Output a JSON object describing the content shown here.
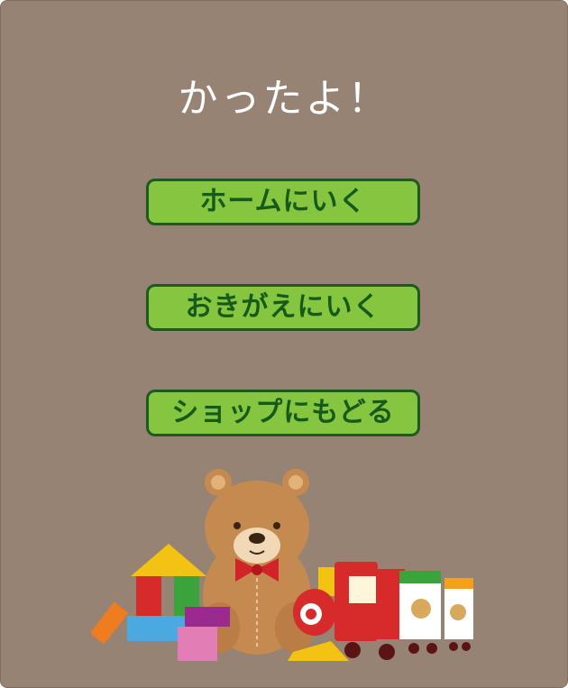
{
  "screen": {
    "title": "かったよ！"
  },
  "buttons": {
    "home": "ホームにいく",
    "memo": "おきがえにいく",
    "shop": "ショップにもどる"
  },
  "colors": {
    "background": "#968373",
    "button_fill": "#86c540",
    "button_border": "#1c5a1f",
    "button_text": "#155a1b",
    "title_text": "#ffffff"
  },
  "illustration": {
    "icon": "toys-teddy-bear-blocks-train-icon"
  }
}
